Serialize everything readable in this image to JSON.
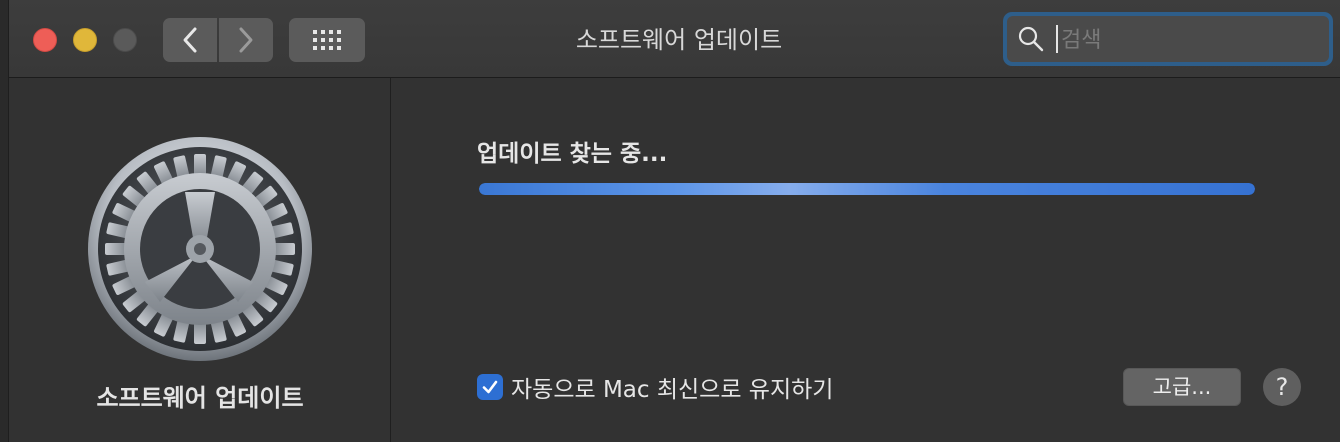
{
  "window": {
    "title": "소프트웨어 업데이트"
  },
  "toolbar": {
    "back_icon": "chevron-left-icon",
    "forward_icon": "chevron-right-icon",
    "grid_icon": "grid-icon"
  },
  "search": {
    "placeholder": "검색",
    "value": ""
  },
  "sidebar": {
    "icon": "gear-icon",
    "label": "소프트웨어 업데이트"
  },
  "main": {
    "status": "업데이트 찾는 중...",
    "progress_percent": 100,
    "auto_update": {
      "checked": true,
      "label": "자동으로 Mac 최신으로 유지하기"
    },
    "advanced_label": "고급...",
    "help_label": "?"
  },
  "colors": {
    "close": "#ee5e57",
    "minimize": "#e0b73a",
    "accent": "#2d6fd3",
    "background": "#323232"
  }
}
